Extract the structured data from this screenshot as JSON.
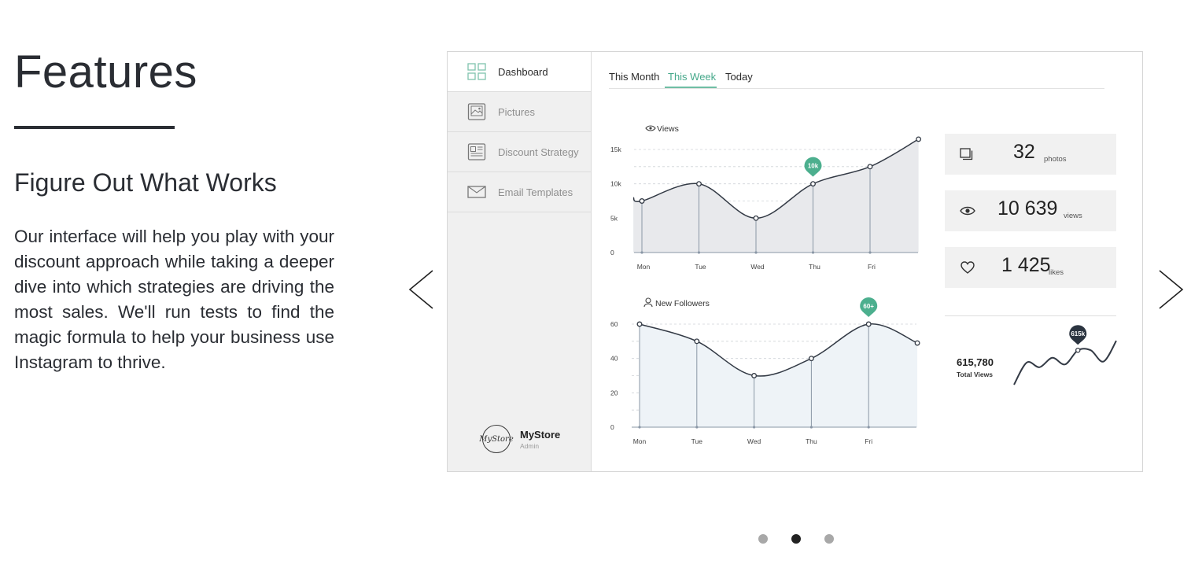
{
  "section": {
    "title": "Features",
    "subtitle": "Figure Out What Works",
    "body": "Our interface will help you play with your discount approach while taking a deeper dive into which strategies are driving the most sales. We'll run tests to find the magic formula to help your business use Instagram to thrive."
  },
  "carousel": {
    "prev_icon": "chevron-left-icon",
    "next_icon": "chevron-right-icon",
    "slide_count": 3,
    "active_slide": 2
  },
  "dashboard": {
    "sidebar": {
      "items": [
        {
          "label": "Dashboard",
          "icon": "grid-icon",
          "active": true
        },
        {
          "label": "Pictures",
          "icon": "picture-icon",
          "active": false
        },
        {
          "label": "Discount Strategy",
          "icon": "newspaper-icon",
          "active": false
        },
        {
          "label": "Email Templates",
          "icon": "envelope-icon",
          "active": false
        }
      ],
      "store": {
        "logo_text": "MyStore",
        "name": "MyStore",
        "role": "Admin"
      }
    },
    "tabs": [
      {
        "label": "This Month",
        "active": false
      },
      {
        "label": "This Week",
        "active": true
      },
      {
        "label": "Today",
        "active": false
      }
    ],
    "stats": [
      {
        "value": "32",
        "unit": "photos",
        "icon": "photos-icon"
      },
      {
        "value": "10 639",
        "unit": "views",
        "icon": "eye-icon"
      },
      {
        "value": "1 425",
        "unit": "likes",
        "icon": "heart-icon"
      }
    ],
    "total": {
      "value": "615,780",
      "label": "Total  Views"
    },
    "colors": {
      "accent": "#4caf8e",
      "dark_marker": "#2b3440",
      "line": "#333a45",
      "views_fill": "#e8e9ec",
      "followers_fill": "#eef3f7"
    }
  },
  "chart_data": [
    {
      "type": "area",
      "title": "Views",
      "title_icon": "eye-icon",
      "categories": [
        "Mon",
        "Tue",
        "Wed",
        "Thu",
        "Fri"
      ],
      "y_ticks": [
        "0",
        "5k",
        "10k",
        "15k"
      ],
      "x": [
        -0.15,
        0,
        1,
        2,
        3,
        4,
        4.85
      ],
      "values": [
        8000,
        7500,
        10000,
        5000,
        10000,
        12500,
        16500
      ],
      "ylim": [
        0,
        15000
      ],
      "highlight": {
        "index": 4,
        "label": "10k"
      },
      "grid": true
    },
    {
      "type": "area",
      "title": "New Followers",
      "title_icon": "user-icon",
      "categories": [
        "Mon",
        "Tue",
        "Wed",
        "Thu",
        "Fri"
      ],
      "y_ticks": [
        "0",
        "20",
        "40",
        "60"
      ],
      "x": [
        0,
        1,
        2,
        3,
        4,
        4.85
      ],
      "values": [
        60,
        50,
        30,
        40,
        60,
        49
      ],
      "ylim": [
        0,
        60
      ],
      "highlight": {
        "index": 4,
        "label": "60+"
      },
      "grid": true
    },
    {
      "type": "line",
      "title": "",
      "values": [
        0.05,
        0.52,
        0.42,
        0.62,
        0.48,
        0.78,
        0.78,
        0.54,
        0.98
      ],
      "highlight": {
        "index": 5,
        "label": "615k"
      }
    }
  ]
}
